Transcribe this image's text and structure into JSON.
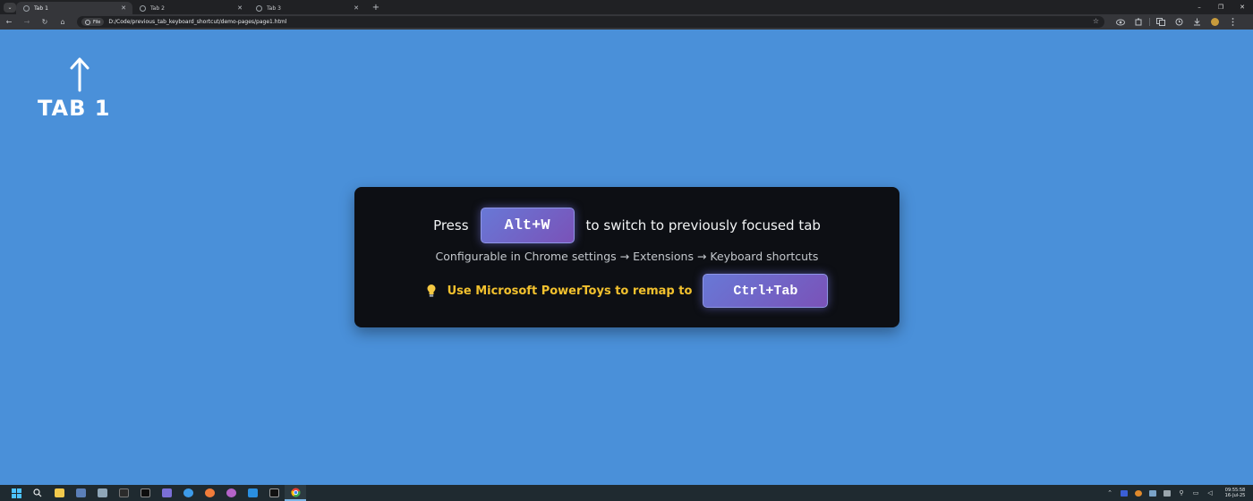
{
  "browser": {
    "tabs": [
      {
        "title": "Tab 1",
        "active": true
      },
      {
        "title": "Tab 2",
        "active": false
      },
      {
        "title": "Tab 3",
        "active": false
      }
    ],
    "new_tab_icon": "plus-icon",
    "window_controls": {
      "minimize": "–",
      "restore": "❐",
      "close": "✕"
    },
    "toolbar": {
      "back": "←",
      "forward": "→",
      "reload": "↻",
      "home": "⌂",
      "chip_label": "File",
      "url": "D:/Code/previous_tab_keyboard_shortcut/demo-pages/page1.html",
      "star": "☆"
    }
  },
  "page": {
    "background": "#4a90d9",
    "arrow_icon": "up-arrow-icon",
    "tab_label": "TAB 1",
    "card": {
      "press": "Press",
      "shortcut": "Alt+W",
      "switch_text": "to switch to previously focused tab",
      "config_text": "Configurable in Chrome settings → Extensions → Keyboard shortcuts",
      "tip_icon": "lightbulb-icon",
      "tip_text": "Use Microsoft PowerToys to remap to",
      "remap_shortcut": "Ctrl+Tab"
    }
  },
  "taskbar": {
    "clock_time": "09:55:58",
    "clock_date": "16-Jul-25"
  }
}
